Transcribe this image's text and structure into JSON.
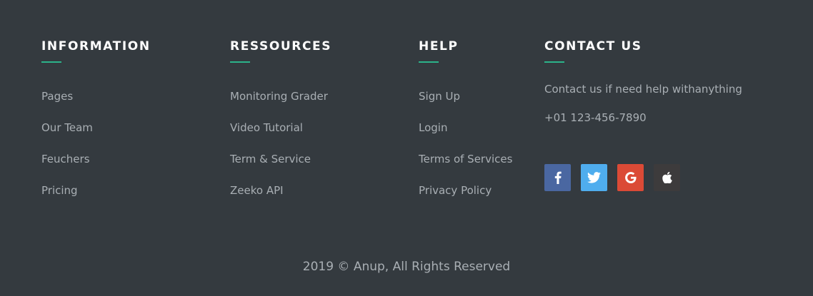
{
  "columns": {
    "information": {
      "title": "INFORMATION",
      "links": [
        "Pages",
        "Our Team",
        "Feuchers",
        "Pricing"
      ]
    },
    "resources": {
      "title": "RESSOURCES",
      "links": [
        "Monitoring Grader",
        "Video Tutorial",
        "Term & Service",
        "Zeeko API"
      ]
    },
    "help": {
      "title": "HELP",
      "links": [
        "Sign Up",
        "Login",
        "Terms of Services",
        "Privacy Policy"
      ]
    },
    "contact": {
      "title": "CONTACT US",
      "text": "Contact us if need help withanything",
      "phone": "+01 123-456-7890"
    }
  },
  "socials": [
    {
      "icon": "facebook-icon",
      "color": "#4a67a1"
    },
    {
      "icon": "twitter-icon",
      "color": "#4fadee"
    },
    {
      "icon": "google-icon",
      "color": "#db4a36"
    },
    {
      "icon": "apple-icon",
      "color": "#3d3b3c"
    }
  ],
  "accent_color": "#2bb38a",
  "copyright": "2019 © Anup, All Rights Reserved"
}
